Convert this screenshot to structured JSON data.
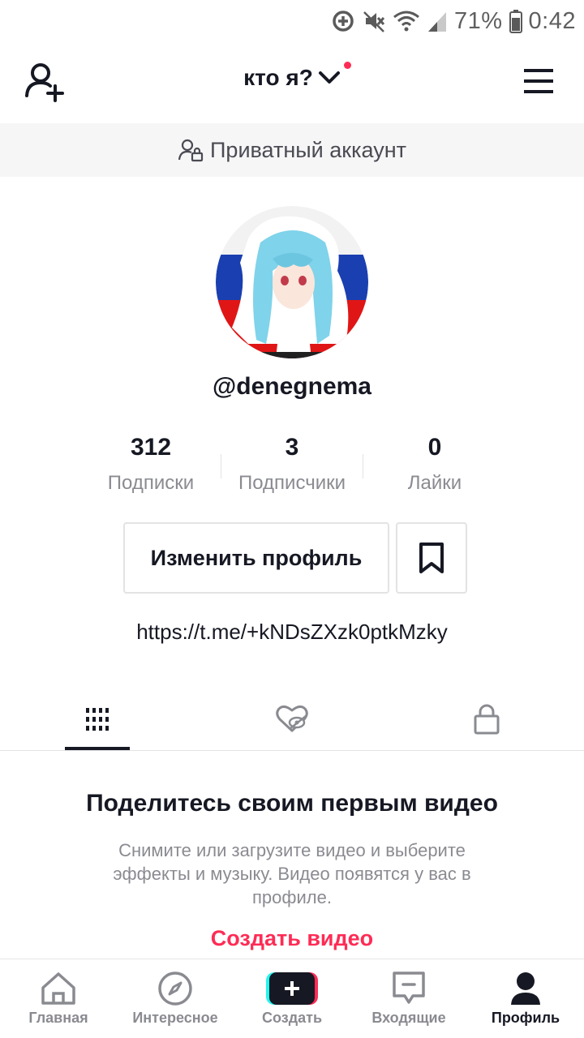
{
  "status_bar": {
    "battery": "71%",
    "time": "0:42"
  },
  "header": {
    "title": "кто я?"
  },
  "private_banner": {
    "text": "Приватный аккаунт"
  },
  "profile": {
    "username": "@denegnema",
    "stats": [
      {
        "value": "312",
        "label": "Подписки"
      },
      {
        "value": "3",
        "label": "Подписчики"
      },
      {
        "value": "0",
        "label": "Лайки"
      }
    ],
    "edit_button": "Изменить профиль",
    "link": "https://t.me/+kNDsZXzk0ptkMzky"
  },
  "tabs": [
    {
      "icon": "grid-icon",
      "active": true
    },
    {
      "icon": "liked-hidden-icon",
      "active": false
    },
    {
      "icon": "lock-icon",
      "active": false
    }
  ],
  "empty_state": {
    "title": "Поделитесь своим первым видео",
    "description": "Снимите или загрузите видео и выберите эффекты и музыку. Видео появятся у вас в профиле.",
    "create_link": "Создать видео"
  },
  "bottom_nav": [
    {
      "label": "Главная",
      "icon": "home-icon"
    },
    {
      "label": "Интересное",
      "icon": "compass-icon"
    },
    {
      "label": "Создать",
      "icon": "plus-icon"
    },
    {
      "label": "Входящие",
      "icon": "inbox-icon"
    },
    {
      "label": "Профиль",
      "icon": "profile-icon",
      "active": true
    }
  ],
  "colors": {
    "accent": "#fe2c55",
    "text": "#161823",
    "muted": "#8a8b91",
    "cyan": "#25f4ee"
  }
}
